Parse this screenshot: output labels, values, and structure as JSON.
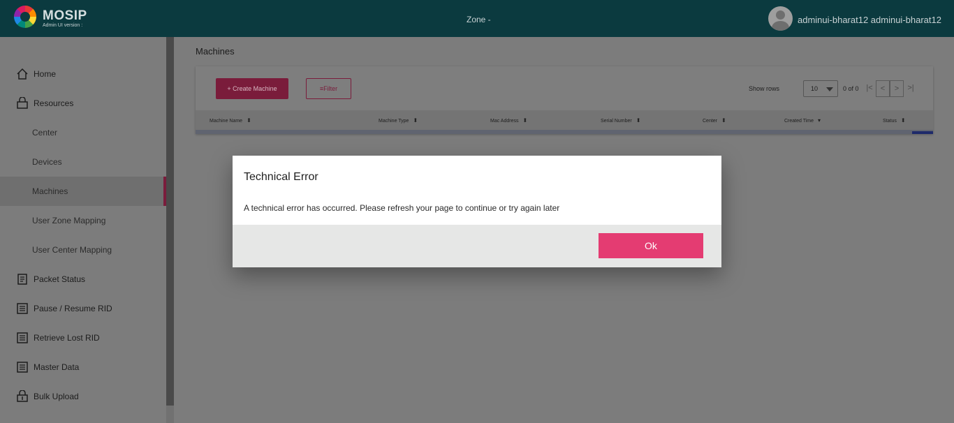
{
  "header": {
    "brand": "MOSIP",
    "version_label": "Admin UI version :",
    "zone_label": "Zone -",
    "username": "adminui-bharat12 adminui-bharat12"
  },
  "sidebar": {
    "items": [
      {
        "label": "Home",
        "icon": "home-icon",
        "level": "top"
      },
      {
        "label": "Resources",
        "icon": "resources-icon",
        "level": "top"
      },
      {
        "label": "Center",
        "level": "sub"
      },
      {
        "label": "Devices",
        "level": "sub"
      },
      {
        "label": "Machines",
        "level": "sub",
        "active": true
      },
      {
        "label": "User Zone Mapping",
        "level": "sub"
      },
      {
        "label": "User Center Mapping",
        "level": "sub"
      },
      {
        "label": "Packet Status",
        "icon": "packet-status-icon",
        "level": "top"
      },
      {
        "label": "Pause / Resume RID",
        "icon": "list-icon",
        "level": "top"
      },
      {
        "label": "Retrieve Lost RID",
        "icon": "list-icon",
        "level": "top"
      },
      {
        "label": "Master Data",
        "icon": "list-icon",
        "level": "top"
      },
      {
        "label": "Bulk Upload",
        "icon": "bulk-upload-icon",
        "level": "top"
      }
    ]
  },
  "main": {
    "page_title": "Machines",
    "create_button": "+ Create Machine",
    "filter_button": "Filter",
    "show_rows_label": "Show rows",
    "rows_per_page": "10",
    "range_text": "0 of 0",
    "columns": [
      "Machine Name",
      "Machine Type",
      "Mac Address",
      "Serial Number",
      "Center",
      "Created Time",
      "Status"
    ]
  },
  "modal": {
    "title": "Technical Error",
    "message": "A technical error has occurred. Please refresh your page to continue or try again later",
    "ok_label": "Ok"
  },
  "colors": {
    "header_bg": "#0b3a3f",
    "accent": "#e43c72",
    "overlay_bg": "#7c7c7c"
  }
}
